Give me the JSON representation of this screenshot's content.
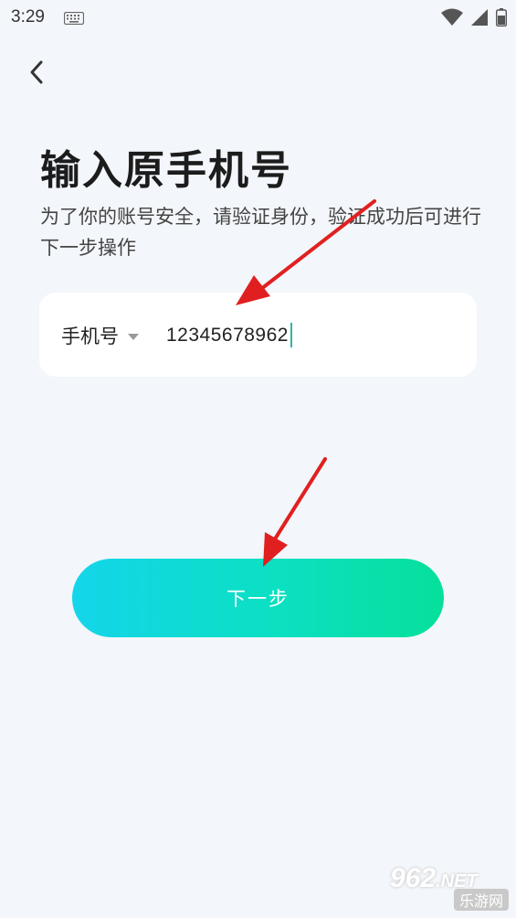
{
  "status_bar": {
    "time": "3:29"
  },
  "page": {
    "title": "输入原手机号",
    "subtitle": "为了你的账号安全，请验证身份，验证成功后可进行下一步操作"
  },
  "phone_field": {
    "label": "手机号",
    "value": "12345678962"
  },
  "next_button": {
    "label": "下一步"
  },
  "watermark": {
    "brand_top": "962",
    "brand_top_suffix": ".NET",
    "brand_bottom": "乐游网"
  },
  "colors": {
    "background": "#f3f6fa",
    "button_gradient_start": "#14d5ea",
    "button_gradient_end": "#06e09b",
    "annotation_arrow": "#e02020"
  }
}
